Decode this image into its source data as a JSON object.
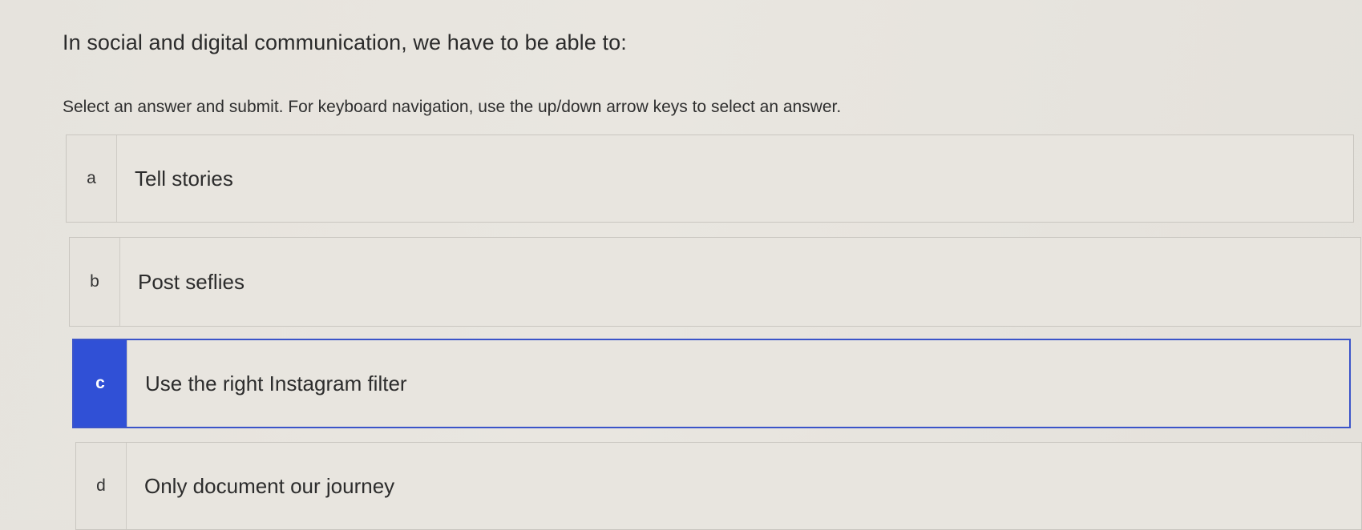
{
  "question": {
    "prompt": "In social and digital communication, we have to be able to:",
    "instructions": "Select an answer and submit. For keyboard navigation, use the up/down arrow keys to select an answer."
  },
  "options": [
    {
      "letter": "a",
      "text": "Tell stories",
      "selected": false
    },
    {
      "letter": "b",
      "text": "Post seflies",
      "selected": false
    },
    {
      "letter": "c",
      "text": "Use the right Instagram filter",
      "selected": true
    },
    {
      "letter": "d",
      "text": "Only document our journey",
      "selected": false
    }
  ],
  "colors": {
    "selected_accent": "#3050d6",
    "background": "#e8e5df"
  }
}
